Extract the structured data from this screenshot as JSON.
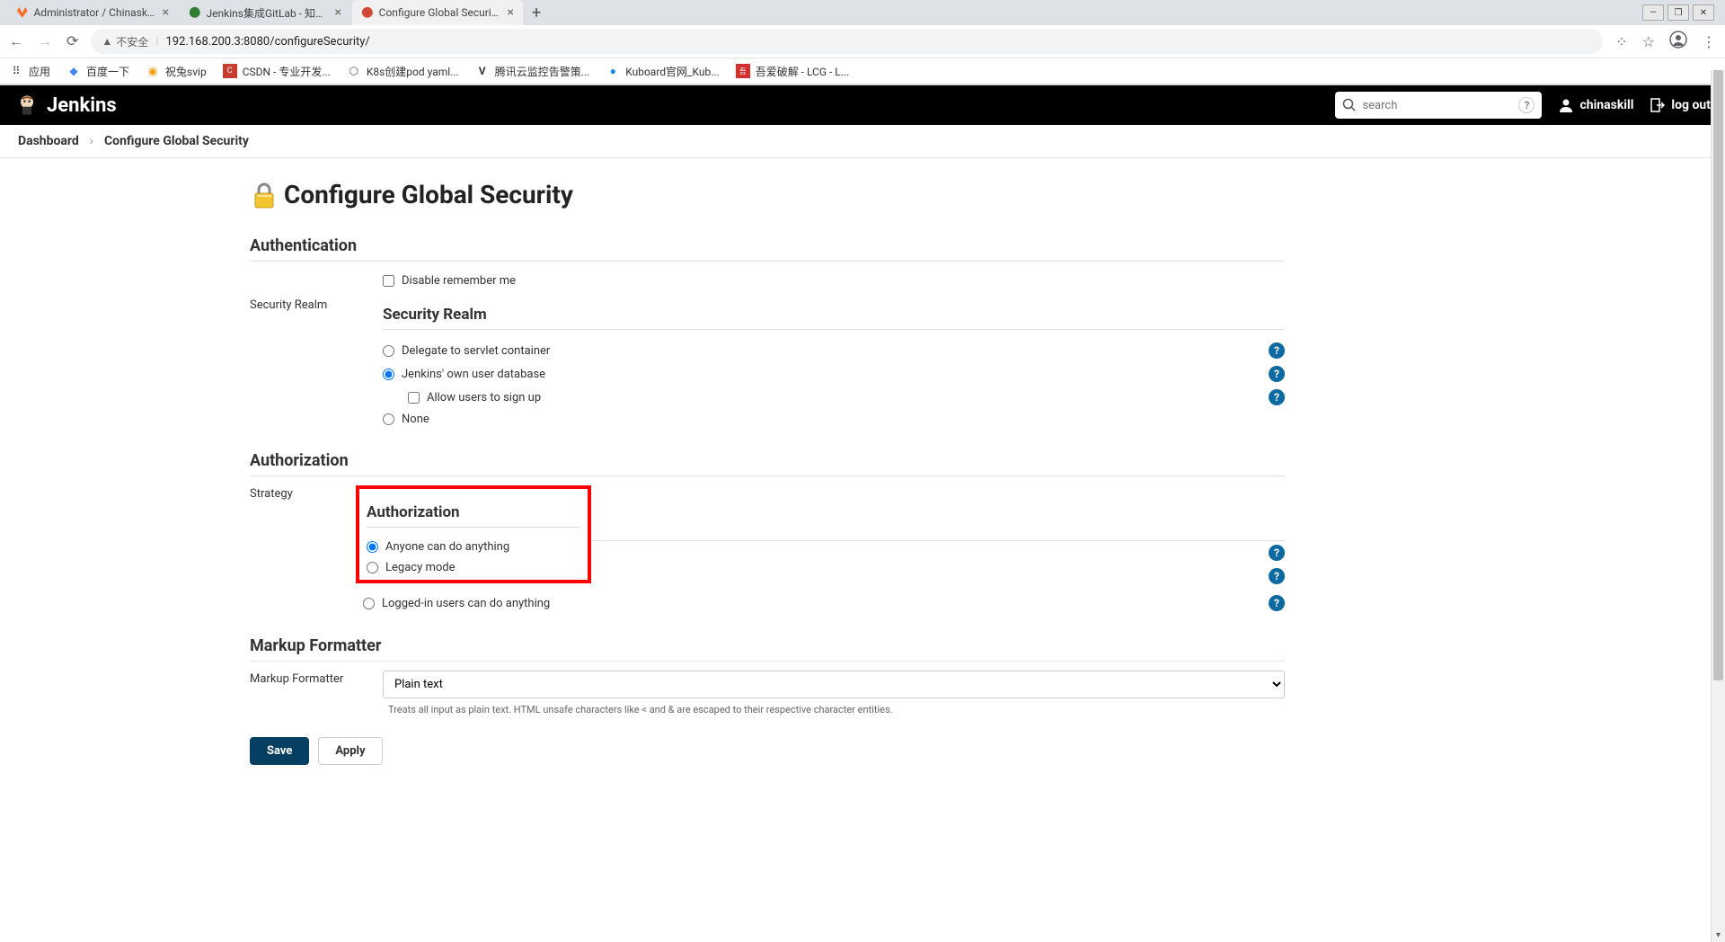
{
  "browser": {
    "tabs": [
      {
        "title": "Administrator / ChinaskillProje",
        "favicon_color": "#fc6d26"
      },
      {
        "title": "Jenkins集成GitLab - 知乎 - osc",
        "favicon_color": "#2e7d32"
      },
      {
        "title": "Configure Global Security [Jen",
        "favicon_color": "#d24939"
      }
    ],
    "url_security": "不安全",
    "url": "192.168.200.3:8080/configureSecurity/",
    "bookmarks_label": "应用",
    "bookmarks": [
      {
        "label": "百度一下",
        "color": "#4285f4"
      },
      {
        "label": "祝兔svip",
        "color": "#ff9800"
      },
      {
        "label": "CSDN - 专业开发...",
        "color": "#c73e2e"
      },
      {
        "label": "K8s创建pod yaml...",
        "color": "#555"
      },
      {
        "label": "腾讯云监控告警策...",
        "color": "#333"
      },
      {
        "label": "Kuboard官网_Kub...",
        "color": "#1e88e5"
      },
      {
        "label": "吾爱破解 - LCG - L...",
        "color": "#d32f2f"
      }
    ]
  },
  "header": {
    "brand": "Jenkins",
    "search_placeholder": "search",
    "username": "chinaskill",
    "logout": "log out"
  },
  "breadcrumbs": [
    {
      "label": "Dashboard"
    },
    {
      "label": "Configure Global Security"
    }
  ],
  "page": {
    "title": "Configure Global Security",
    "sections": {
      "authentication": {
        "title": "Authentication",
        "disable_remember": "Disable remember me",
        "security_realm_label": "Security Realm",
        "security_realm_heading": "Security Realm",
        "options": {
          "delegate": "Delegate to servlet container",
          "own_db": "Jenkins' own user database",
          "allow_signup": "Allow users to sign up",
          "none": "None"
        }
      },
      "authorization": {
        "title": "Authorization",
        "strategy_label": "Strategy",
        "heading": "Authorization",
        "options": {
          "anyone": "Anyone can do anything",
          "legacy": "Legacy mode",
          "loggedin": "Logged-in users can do anything"
        }
      },
      "markup": {
        "title": "Markup Formatter",
        "label": "Markup Formatter",
        "selected": "Plain text",
        "help_text": "Treats all input as plain text. HTML unsafe characters like < and & are escaped to their respective character entities."
      }
    },
    "buttons": {
      "save": "Save",
      "apply": "Apply"
    }
  }
}
